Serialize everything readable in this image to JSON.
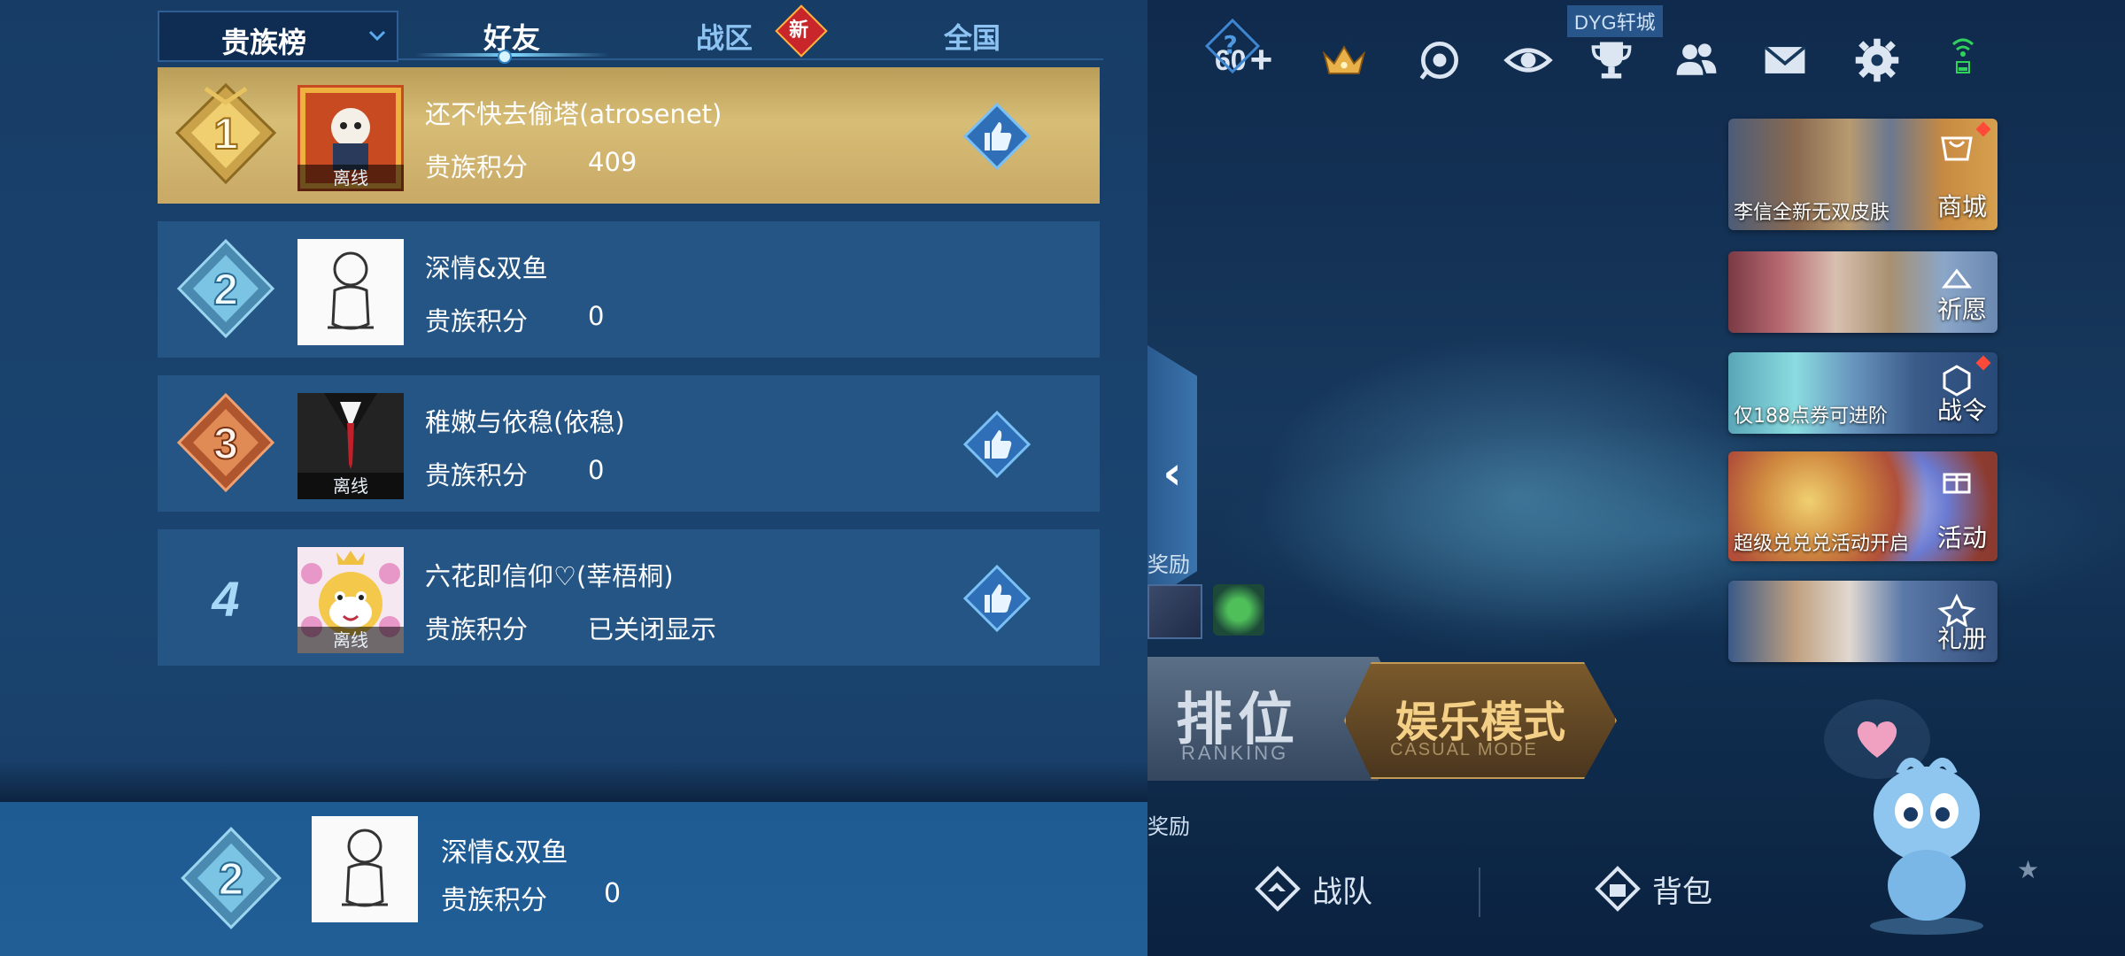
{
  "tabs": {
    "board_selector": "贵族榜",
    "friends": "好友",
    "region": "战区",
    "region_badge": "新",
    "national": "全国",
    "help": "?"
  },
  "leaderboard": {
    "offline_label": "离线",
    "rows": [
      {
        "rank": "1",
        "name": "还不快去偷塔(atrosenet)",
        "score_label": "贵族积分",
        "score": "409",
        "offline": true,
        "likeable": true
      },
      {
        "rank": "2",
        "name": "深情&双鱼",
        "score_label": "贵族积分",
        "score": "0",
        "offline": false,
        "likeable": false
      },
      {
        "rank": "3",
        "name": "稚嫩与依稳(依稳)",
        "score_label": "贵族积分",
        "score": "0",
        "offline": true,
        "likeable": true
      },
      {
        "rank": "4",
        "name": "六花即信仰♡(莘梧桐)",
        "score_label": "贵族积分",
        "score": "已关闭显示",
        "offline": true,
        "likeable": true
      }
    ]
  },
  "self": {
    "rank": "2",
    "name": "深情&双鱼",
    "score_label": "贵族积分",
    "score": "0"
  },
  "lobby": {
    "coins_add": "60",
    "server_tag": "DYG轩城",
    "cards": [
      {
        "caption": "李信全新无双皮肤",
        "label": "商城"
      },
      {
        "caption": "",
        "label": "祈愿"
      },
      {
        "caption": "仅188点券可进阶",
        "label": "战令"
      },
      {
        "caption": "超级兑兑兑活动开启",
        "label": "活动"
      },
      {
        "caption": "",
        "label": "礼册"
      }
    ],
    "rewards_label": "奖励",
    "rewards_label_2": "奖励",
    "ranking": {
      "title": "排位",
      "subtitle": "RANKING"
    },
    "casual": {
      "title": "娱乐模式",
      "subtitle": "CASUAL MODE"
    },
    "team": "战队",
    "bag": "背包"
  },
  "colors": {
    "gold_row": "#c8a966",
    "row_bg": "#245584",
    "panel_bg": "#1a4470",
    "accent": "#7fd6ff"
  }
}
